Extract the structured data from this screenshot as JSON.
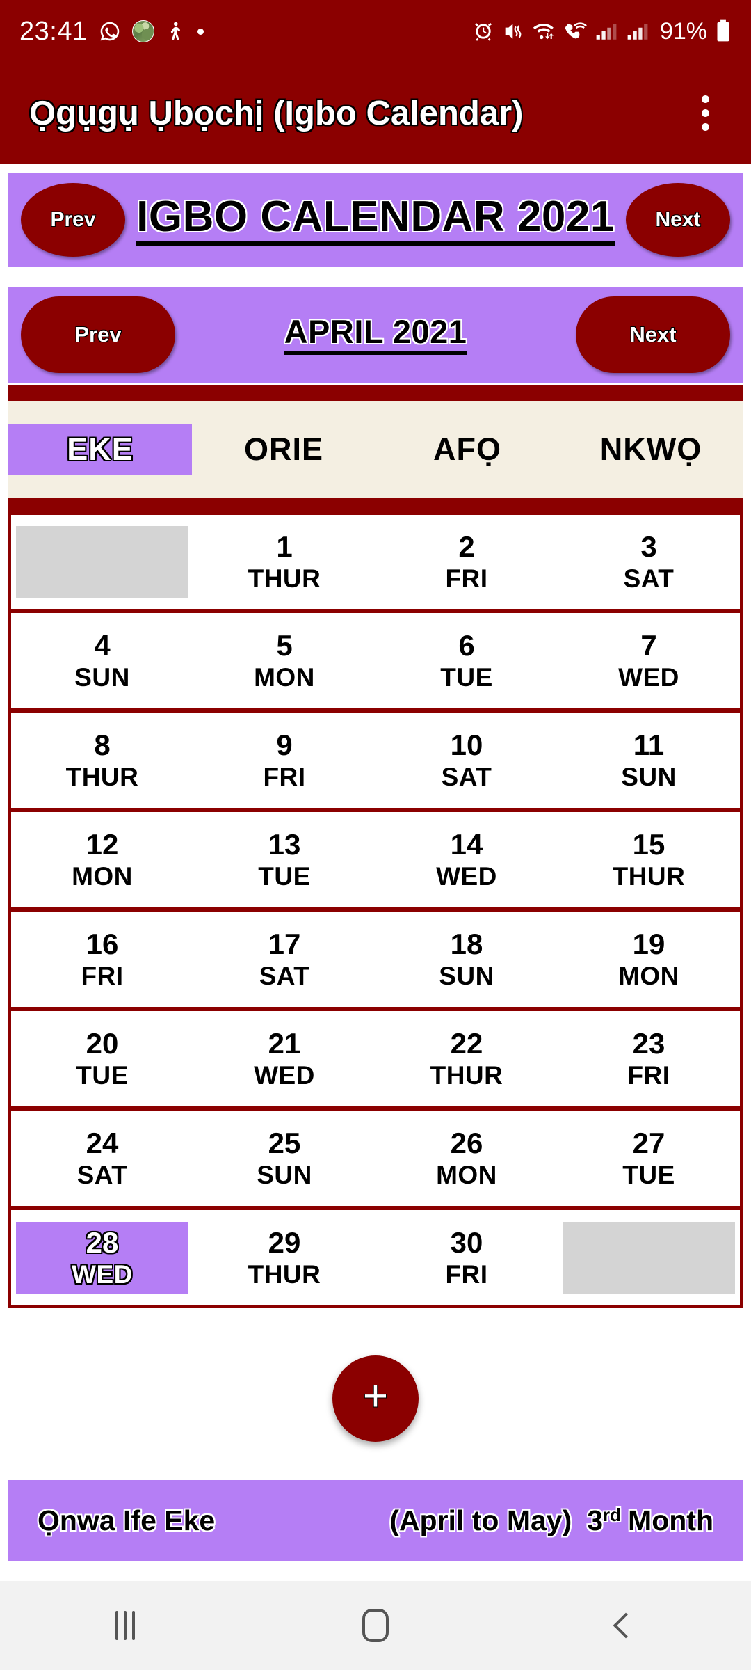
{
  "status_bar": {
    "time": "23:41",
    "battery_percent": "91%",
    "left_icons": [
      "whatsapp-icon",
      "photo-icon",
      "person-icon",
      "dot-icon"
    ],
    "right_icons": [
      "alarm-icon",
      "mute-vibrate-icon",
      "wifi-icon",
      "wifi-calling-icon",
      "signal-bars-1-icon",
      "signal-bars-2-icon",
      "battery-icon"
    ]
  },
  "app_bar": {
    "title": "Ọgụgụ Ụbọchị (Igbo Calendar)",
    "overflow_menu": "overflow-menu-icon"
  },
  "year_bar": {
    "prev_label": "Prev",
    "title": "IGBO CALENDAR 2021",
    "next_label": "Next"
  },
  "month_bar": {
    "prev_label": "Prev",
    "title": "APRIL 2021",
    "next_label": "Next"
  },
  "day_names": [
    {
      "label": "EKE",
      "active": true
    },
    {
      "label": "ORIE",
      "active": false
    },
    {
      "label": "AFỌ",
      "active": false
    },
    {
      "label": "NKWỌ",
      "active": false
    }
  ],
  "calendar": {
    "rows": [
      [
        {
          "empty": true
        },
        {
          "num": "1",
          "dow": "THUR"
        },
        {
          "num": "2",
          "dow": "FRI"
        },
        {
          "num": "3",
          "dow": "SAT"
        }
      ],
      [
        {
          "num": "4",
          "dow": "SUN"
        },
        {
          "num": "5",
          "dow": "MON"
        },
        {
          "num": "6",
          "dow": "TUE"
        },
        {
          "num": "7",
          "dow": "WED"
        }
      ],
      [
        {
          "num": "8",
          "dow": "THUR"
        },
        {
          "num": "9",
          "dow": "FRI"
        },
        {
          "num": "10",
          "dow": "SAT"
        },
        {
          "num": "11",
          "dow": "SUN"
        }
      ],
      [
        {
          "num": "12",
          "dow": "MON"
        },
        {
          "num": "13",
          "dow": "TUE"
        },
        {
          "num": "14",
          "dow": "WED"
        },
        {
          "num": "15",
          "dow": "THUR"
        }
      ],
      [
        {
          "num": "16",
          "dow": "FRI"
        },
        {
          "num": "17",
          "dow": "SAT"
        },
        {
          "num": "18",
          "dow": "SUN"
        },
        {
          "num": "19",
          "dow": "MON"
        }
      ],
      [
        {
          "num": "20",
          "dow": "TUE"
        },
        {
          "num": "21",
          "dow": "WED"
        },
        {
          "num": "22",
          "dow": "THUR"
        },
        {
          "num": "23",
          "dow": "FRI"
        }
      ],
      [
        {
          "num": "24",
          "dow": "SAT"
        },
        {
          "num": "25",
          "dow": "SUN"
        },
        {
          "num": "26",
          "dow": "MON"
        },
        {
          "num": "27",
          "dow": "TUE"
        }
      ],
      [
        {
          "num": "28",
          "dow": "WED",
          "today": true
        },
        {
          "num": "29",
          "dow": "THUR"
        },
        {
          "num": "30",
          "dow": "FRI"
        },
        {
          "empty": true
        }
      ]
    ]
  },
  "fab": {
    "label": "+"
  },
  "footer_info": {
    "igbo_month": "Ọnwa Ife Eke",
    "gregorian_span": "(April to May)",
    "ordinal_number": "3",
    "ordinal_suffix": "rd",
    "month_word": "Month"
  },
  "android_nav": {
    "recents": "recents-icon",
    "home": "home-icon",
    "back": "back-icon"
  },
  "colors": {
    "primary_dark_red": "#8B0000",
    "accent_purple": "#B57EF5",
    "header_cream": "#F4EFE2",
    "placeholder_gray": "#D4D4D4"
  }
}
